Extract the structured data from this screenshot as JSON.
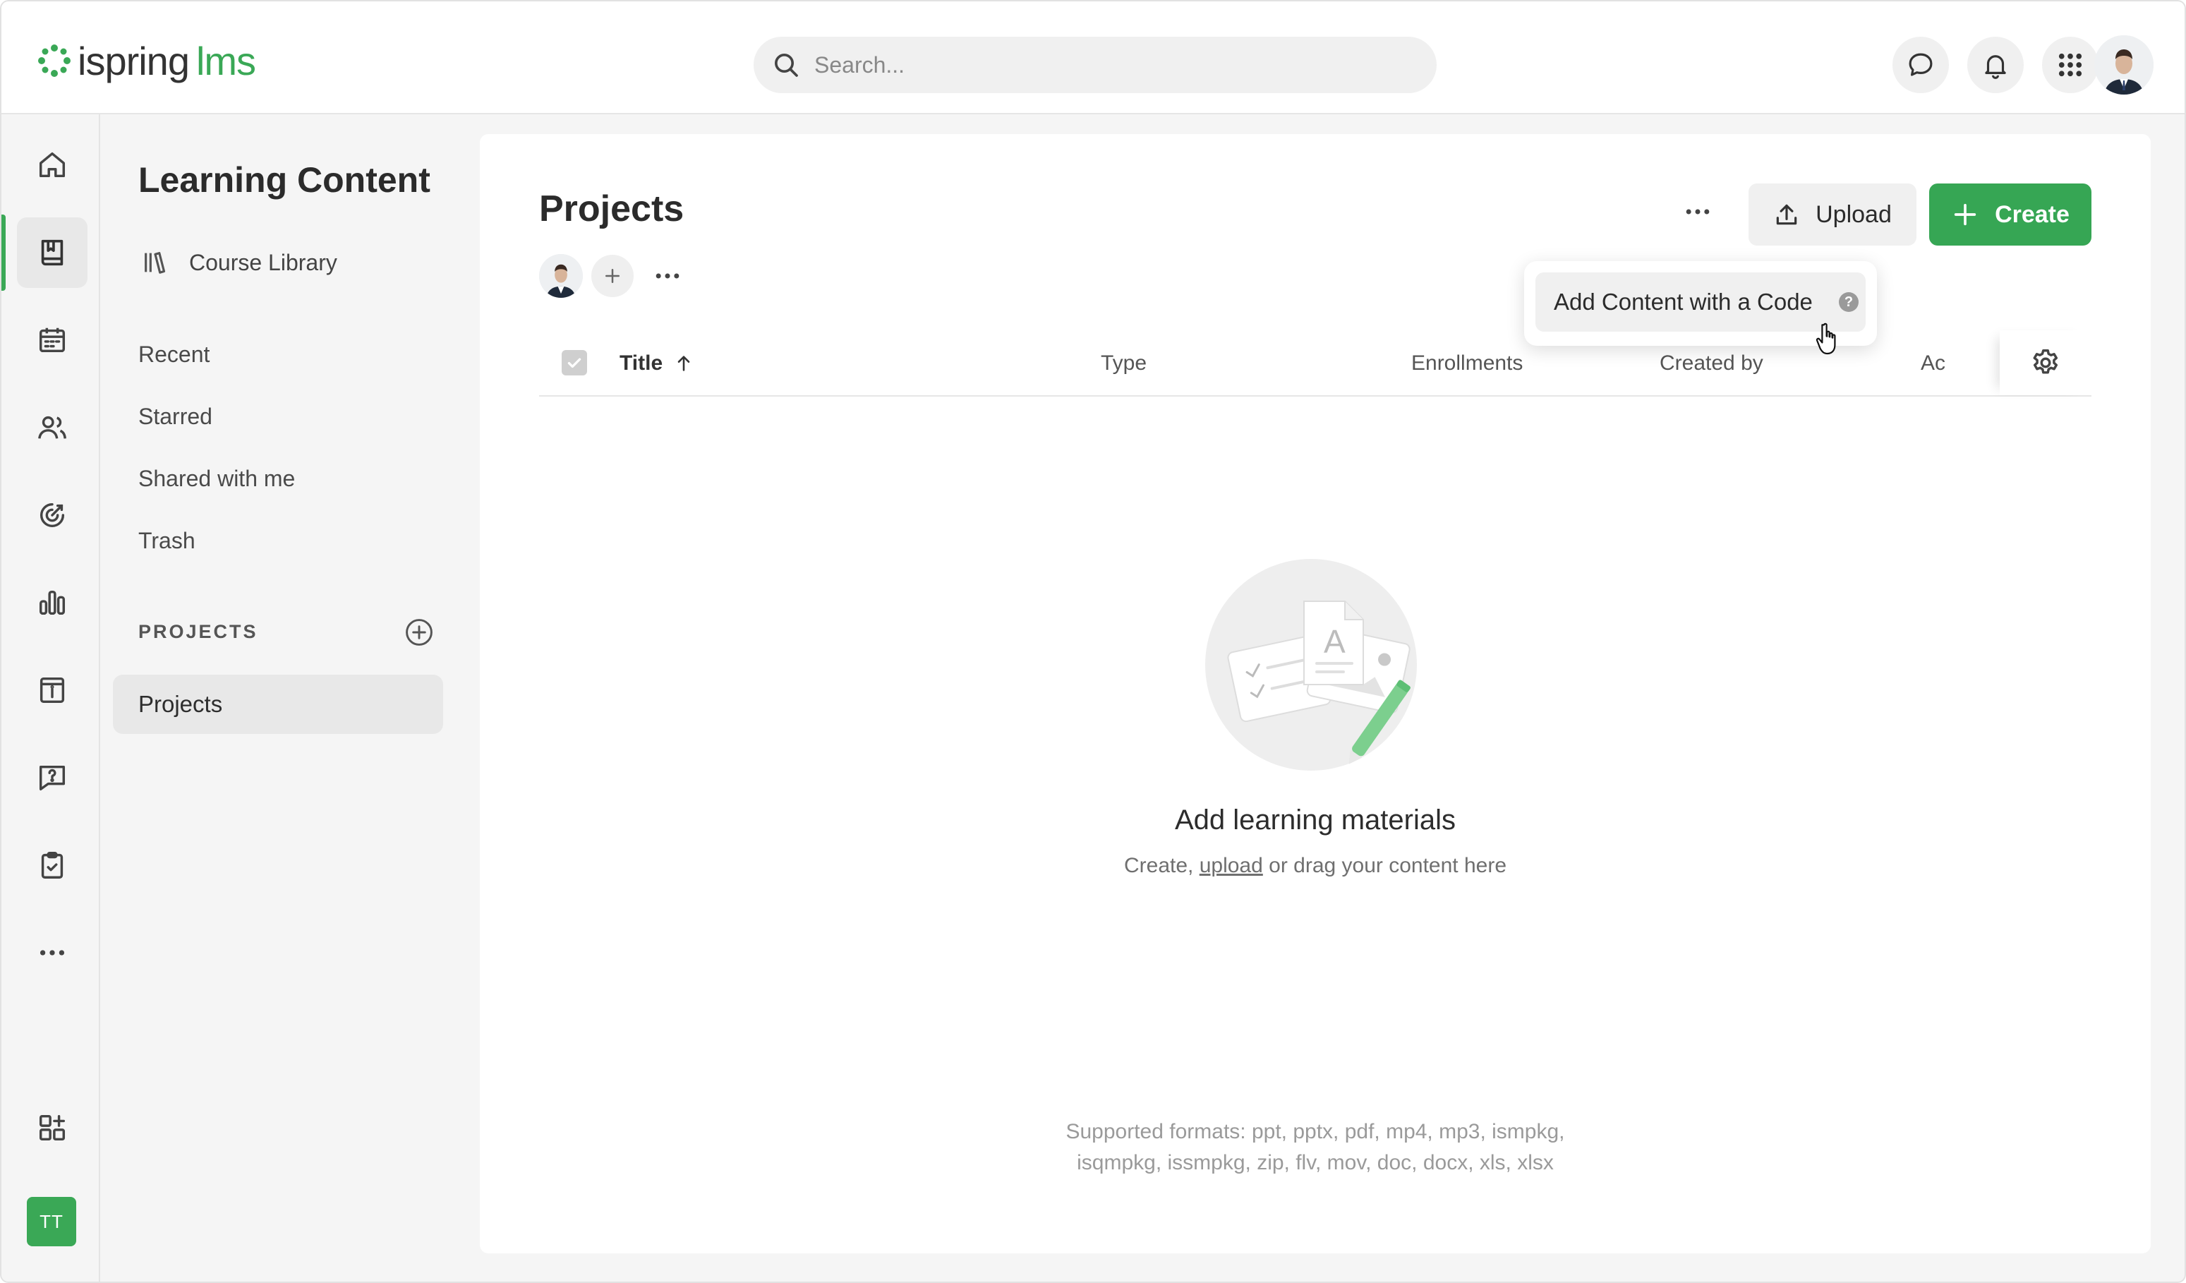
{
  "app": {
    "logo_word": "ispring",
    "logo_suffix": "lms"
  },
  "search": {
    "placeholder": "Search..."
  },
  "rail": {
    "items": [
      "home-icon",
      "book-icon",
      "calendar-icon",
      "users-icon",
      "target-icon",
      "bar-chart-icon",
      "info-doc-icon",
      "question-message-icon",
      "clipboard-check-icon",
      "more-horizontal-icon",
      "apps-add-icon"
    ],
    "user_initials": "TT",
    "accent": "#3aa856"
  },
  "sidebar": {
    "title": "Learning Content",
    "course_library": "Course Library",
    "links": [
      "Recent",
      "Starred",
      "Shared with me",
      "Trash"
    ],
    "projects_header": "PROJECTS",
    "projects": [
      "Projects"
    ]
  },
  "main": {
    "title": "Projects",
    "upload_label": "Upload",
    "create_label": "Create",
    "dropdown_item": "Add Content with a Code",
    "help_mark": "?",
    "columns": [
      "Title",
      "Type",
      "Enrollments",
      "Created by",
      "Ac"
    ],
    "empty_title": "Add learning materials",
    "empty_sub_prefix": "Create, ",
    "empty_sub_link": "upload",
    "empty_sub_suffix": " or drag your content here",
    "formats_line1": "Supported formats: ppt, pptx, pdf, mp4, mp3, ismpkg,",
    "formats_line2": "isqmpkg, issmpkg, zip, flv, mov, doc, docx, xls, xlsx"
  },
  "colors": {
    "brand_green": "#36a654",
    "panel": "#ffffff",
    "background": "#f5f5f5"
  }
}
